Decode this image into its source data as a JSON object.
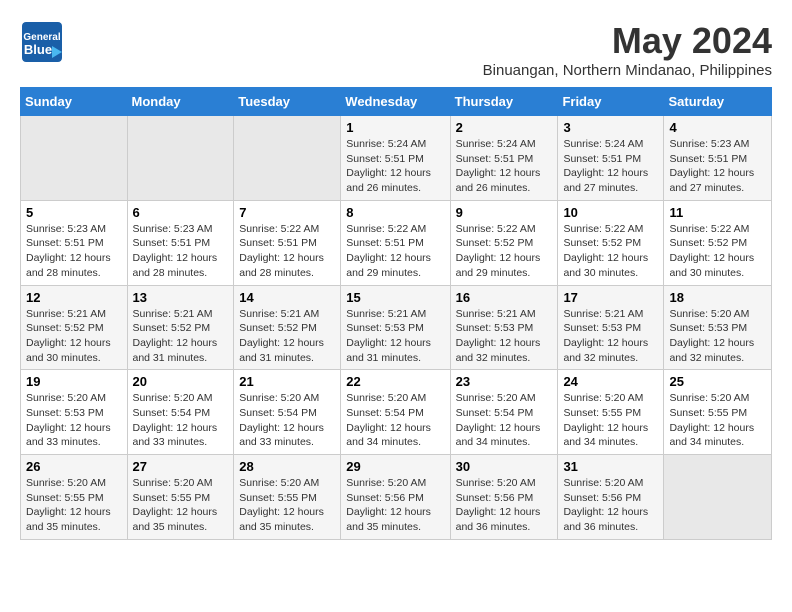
{
  "header": {
    "logo_general": "General",
    "logo_blue": "Blue",
    "month_title": "May 2024",
    "subtitle": "Binuangan, Northern Mindanao, Philippines"
  },
  "calendar": {
    "days_of_week": [
      "Sunday",
      "Monday",
      "Tuesday",
      "Wednesday",
      "Thursday",
      "Friday",
      "Saturday"
    ],
    "weeks": [
      [
        {
          "day": "",
          "info": ""
        },
        {
          "day": "",
          "info": ""
        },
        {
          "day": "",
          "info": ""
        },
        {
          "day": "1",
          "info": "Sunrise: 5:24 AM\nSunset: 5:51 PM\nDaylight: 12 hours\nand 26 minutes."
        },
        {
          "day": "2",
          "info": "Sunrise: 5:24 AM\nSunset: 5:51 PM\nDaylight: 12 hours\nand 26 minutes."
        },
        {
          "day": "3",
          "info": "Sunrise: 5:24 AM\nSunset: 5:51 PM\nDaylight: 12 hours\nand 27 minutes."
        },
        {
          "day": "4",
          "info": "Sunrise: 5:23 AM\nSunset: 5:51 PM\nDaylight: 12 hours\nand 27 minutes."
        }
      ],
      [
        {
          "day": "5",
          "info": "Sunrise: 5:23 AM\nSunset: 5:51 PM\nDaylight: 12 hours\nand 28 minutes."
        },
        {
          "day": "6",
          "info": "Sunrise: 5:23 AM\nSunset: 5:51 PM\nDaylight: 12 hours\nand 28 minutes."
        },
        {
          "day": "7",
          "info": "Sunrise: 5:22 AM\nSunset: 5:51 PM\nDaylight: 12 hours\nand 28 minutes."
        },
        {
          "day": "8",
          "info": "Sunrise: 5:22 AM\nSunset: 5:51 PM\nDaylight: 12 hours\nand 29 minutes."
        },
        {
          "day": "9",
          "info": "Sunrise: 5:22 AM\nSunset: 5:52 PM\nDaylight: 12 hours\nand 29 minutes."
        },
        {
          "day": "10",
          "info": "Sunrise: 5:22 AM\nSunset: 5:52 PM\nDaylight: 12 hours\nand 30 minutes."
        },
        {
          "day": "11",
          "info": "Sunrise: 5:22 AM\nSunset: 5:52 PM\nDaylight: 12 hours\nand 30 minutes."
        }
      ],
      [
        {
          "day": "12",
          "info": "Sunrise: 5:21 AM\nSunset: 5:52 PM\nDaylight: 12 hours\nand 30 minutes."
        },
        {
          "day": "13",
          "info": "Sunrise: 5:21 AM\nSunset: 5:52 PM\nDaylight: 12 hours\nand 31 minutes."
        },
        {
          "day": "14",
          "info": "Sunrise: 5:21 AM\nSunset: 5:52 PM\nDaylight: 12 hours\nand 31 minutes."
        },
        {
          "day": "15",
          "info": "Sunrise: 5:21 AM\nSunset: 5:53 PM\nDaylight: 12 hours\nand 31 minutes."
        },
        {
          "day": "16",
          "info": "Sunrise: 5:21 AM\nSunset: 5:53 PM\nDaylight: 12 hours\nand 32 minutes."
        },
        {
          "day": "17",
          "info": "Sunrise: 5:21 AM\nSunset: 5:53 PM\nDaylight: 12 hours\nand 32 minutes."
        },
        {
          "day": "18",
          "info": "Sunrise: 5:20 AM\nSunset: 5:53 PM\nDaylight: 12 hours\nand 32 minutes."
        }
      ],
      [
        {
          "day": "19",
          "info": "Sunrise: 5:20 AM\nSunset: 5:53 PM\nDaylight: 12 hours\nand 33 minutes."
        },
        {
          "day": "20",
          "info": "Sunrise: 5:20 AM\nSunset: 5:54 PM\nDaylight: 12 hours\nand 33 minutes."
        },
        {
          "day": "21",
          "info": "Sunrise: 5:20 AM\nSunset: 5:54 PM\nDaylight: 12 hours\nand 33 minutes."
        },
        {
          "day": "22",
          "info": "Sunrise: 5:20 AM\nSunset: 5:54 PM\nDaylight: 12 hours\nand 34 minutes."
        },
        {
          "day": "23",
          "info": "Sunrise: 5:20 AM\nSunset: 5:54 PM\nDaylight: 12 hours\nand 34 minutes."
        },
        {
          "day": "24",
          "info": "Sunrise: 5:20 AM\nSunset: 5:55 PM\nDaylight: 12 hours\nand 34 minutes."
        },
        {
          "day": "25",
          "info": "Sunrise: 5:20 AM\nSunset: 5:55 PM\nDaylight: 12 hours\nand 34 minutes."
        }
      ],
      [
        {
          "day": "26",
          "info": "Sunrise: 5:20 AM\nSunset: 5:55 PM\nDaylight: 12 hours\nand 35 minutes."
        },
        {
          "day": "27",
          "info": "Sunrise: 5:20 AM\nSunset: 5:55 PM\nDaylight: 12 hours\nand 35 minutes."
        },
        {
          "day": "28",
          "info": "Sunrise: 5:20 AM\nSunset: 5:55 PM\nDaylight: 12 hours\nand 35 minutes."
        },
        {
          "day": "29",
          "info": "Sunrise: 5:20 AM\nSunset: 5:56 PM\nDaylight: 12 hours\nand 35 minutes."
        },
        {
          "day": "30",
          "info": "Sunrise: 5:20 AM\nSunset: 5:56 PM\nDaylight: 12 hours\nand 36 minutes."
        },
        {
          "day": "31",
          "info": "Sunrise: 5:20 AM\nSunset: 5:56 PM\nDaylight: 12 hours\nand 36 minutes."
        },
        {
          "day": "",
          "info": ""
        }
      ]
    ]
  }
}
